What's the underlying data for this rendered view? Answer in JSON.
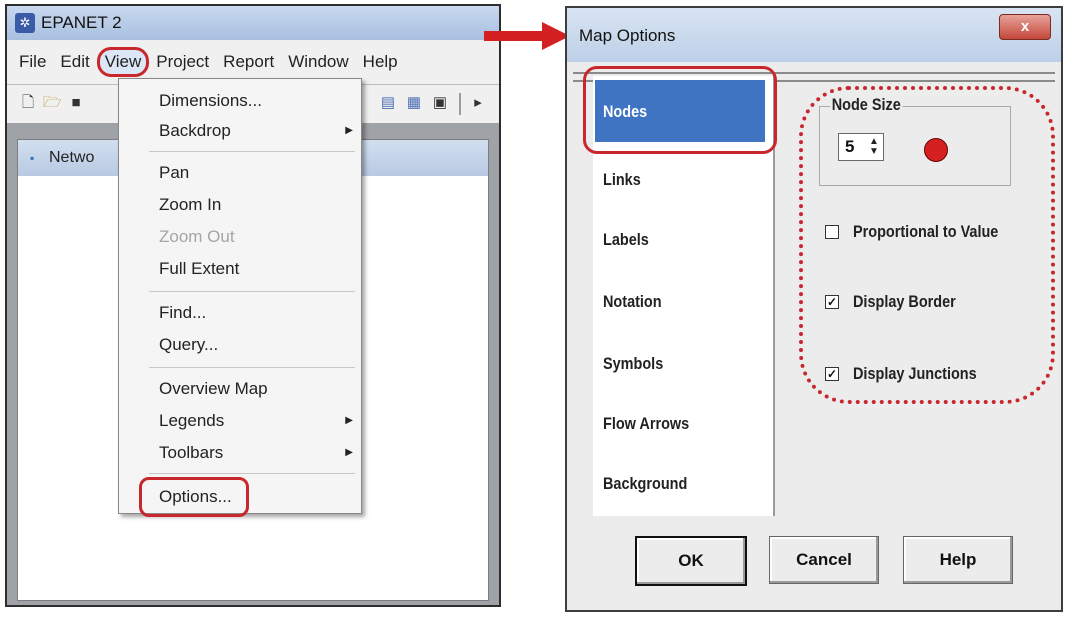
{
  "epanet": {
    "title": "EPANET 2",
    "menu": [
      "File",
      "Edit",
      "View",
      "Project",
      "Report",
      "Window",
      "Help"
    ],
    "network_title": "Netwo",
    "view_menu": [
      {
        "label": "Dimensions...",
        "enabled": true,
        "submenu": false
      },
      {
        "label": "Backdrop",
        "enabled": true,
        "submenu": true
      },
      {
        "label": "Pan",
        "enabled": true,
        "submenu": false
      },
      {
        "label": "Zoom In",
        "enabled": true,
        "submenu": false
      },
      {
        "label": "Zoom Out",
        "enabled": false,
        "submenu": false
      },
      {
        "label": "Full Extent",
        "enabled": true,
        "submenu": false
      },
      {
        "label": "Find...",
        "enabled": true,
        "submenu": false
      },
      {
        "label": "Query...",
        "enabled": true,
        "submenu": false
      },
      {
        "label": "Overview Map",
        "enabled": true,
        "submenu": false
      },
      {
        "label": "Legends",
        "enabled": true,
        "submenu": true
      },
      {
        "label": "Toolbars",
        "enabled": true,
        "submenu": true
      },
      {
        "label": "Options...",
        "enabled": true,
        "submenu": false
      }
    ]
  },
  "dialog": {
    "title": "Map Options",
    "close": "x",
    "tabs": [
      "Nodes",
      "Links",
      "Labels",
      "Notation",
      "Symbols",
      "Flow Arrows",
      "Background"
    ],
    "selected_tab": "Nodes",
    "node_size_label": "Node Size",
    "node_size_value": "5",
    "node_color": "#d42020",
    "checkboxes": [
      {
        "label": "Proportional to Value",
        "checked": false
      },
      {
        "label": "Display Border",
        "checked": true
      },
      {
        "label": "Display Junctions",
        "checked": true
      }
    ],
    "buttons": {
      "ok": "OK",
      "cancel": "Cancel",
      "help": "Help"
    }
  },
  "accent": "#c8282c"
}
